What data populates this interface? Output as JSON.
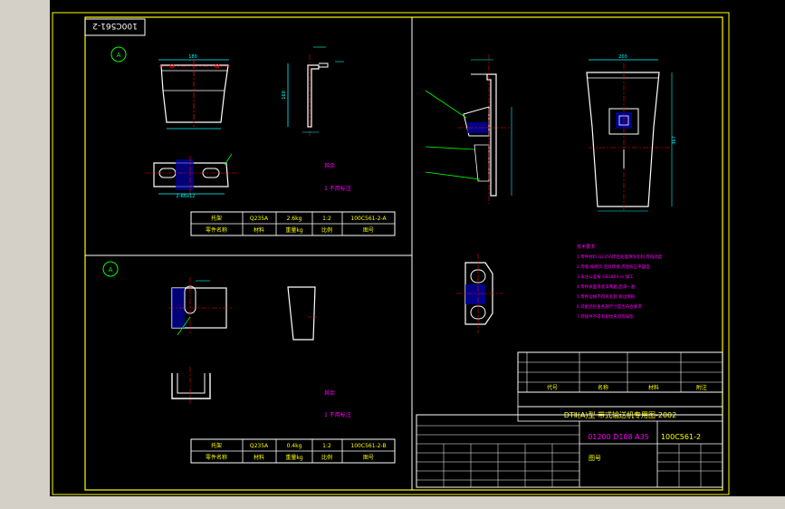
{
  "drawing": {
    "frame_code_rotated": "100C561-2",
    "view_marker_top": "A",
    "view_marker_bottom": "A",
    "title_block": {
      "standard_title": "DTⅡ(A)型 带式输送机专用图-2002",
      "drawing_number": "100C561-2",
      "model_codes": "01200 D108 A35",
      "weight_label": "图号",
      "material_note_header": "附注",
      "header_cols": [
        "代号",
        "名称",
        "材料",
        "附注"
      ]
    },
    "parts_top": {
      "row1": [
        "托架",
        "Q235A",
        "2.6kg",
        "1:2",
        "100C561-2-A"
      ],
      "row2": [
        "零件名称",
        "材料",
        "重量kg",
        "比例",
        "图号"
      ]
    },
    "parts_bottom": {
      "row1": [
        "托架",
        "Q235A",
        "0.4kg",
        "1:2",
        "100C561-2-B"
      ],
      "row2": [
        "零件名称",
        "材料",
        "重量kg",
        "比例",
        "图号"
      ]
    },
    "notes_title": "技术要求",
    "notes": [
      "1.零件材料 Q235A焊后处理清除毛刺,焊缝高度",
      "2.焊缝 按图示 连续焊接,焊后校正平面度",
      "3.未注公差按 GB1804-m 加工",
      "4.零件表面涂底漆两遍,面漆一遍",
      "5.零件边缘不得有毛刺,锐边倒钝",
      "6.装配后检查各部尺寸是否符合要求",
      "7.焊接件不得有裂纹夹渣等缺陷"
    ],
    "roughness_label_top": "其余",
    "roughness_label_bottom": "其余",
    "weld_note_top": "1 不用标注",
    "weld_note_bottom": "1 不用标注",
    "dim_labels": {
      "top_width": "180",
      "side_height": "160",
      "right_width": "200",
      "right_height": "367",
      "slot_label": "2-R6x12"
    },
    "colors": {
      "background": "#000000",
      "frame": "#ffff00",
      "outline": "#ffffff",
      "dimension": "#00ffff",
      "center": "#ff0000",
      "note": "#ff00ff",
      "leader": "#00ff00",
      "ui": "#d4d0c8"
    }
  }
}
